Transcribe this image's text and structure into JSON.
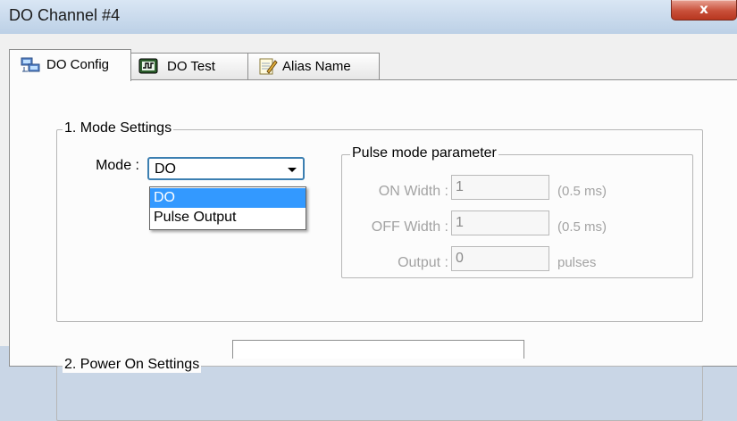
{
  "window": {
    "title": "DO Channel #4",
    "close_label": "x"
  },
  "tabs": [
    {
      "label": "DO Config",
      "icon": "network-config-icon",
      "active": true
    },
    {
      "label": "DO Test",
      "icon": "monitor-test-icon",
      "active": false
    },
    {
      "label": "Alias Name",
      "icon": "notepad-pencil-icon",
      "active": false
    }
  ],
  "mode_settings": {
    "legend": "1. Mode Settings",
    "mode_label": "Mode :",
    "mode_value": "DO",
    "options": [
      "DO",
      "Pulse Output"
    ],
    "selected_option": "DO"
  },
  "pulse": {
    "legend": "Pulse mode parameter",
    "on_width_label": "ON Width :",
    "on_width_value": "1",
    "on_width_unit": "(0.5 ms)",
    "off_width_label": "OFF Width :",
    "off_width_value": "1",
    "off_width_unit": "(0.5 ms)",
    "output_label": "Output :",
    "output_value": "0",
    "output_unit": "pulses"
  },
  "power_on": {
    "legend": "2. Power On Settings"
  },
  "colors": {
    "selection": "#3399ff",
    "focus_border": "#3c7fb1",
    "close_button": "#c9503a",
    "titlebar": "#c9d6e6"
  }
}
